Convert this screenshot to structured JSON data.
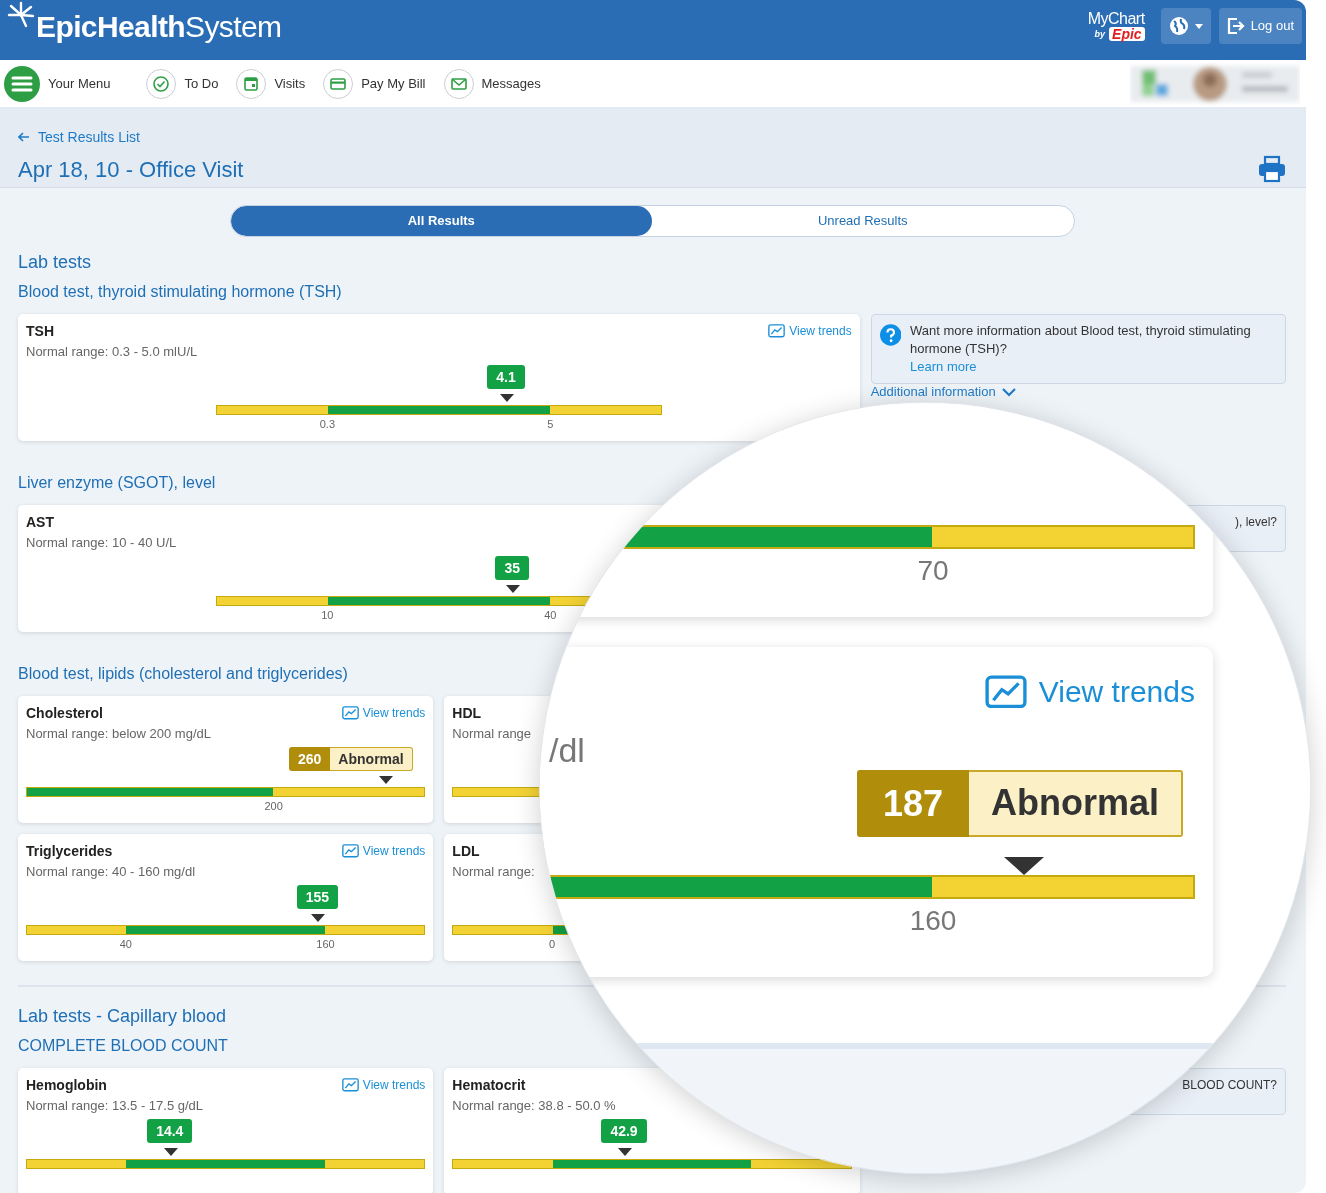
{
  "header": {
    "logo": "**EpicHealth**System",
    "mychart_logo": [
      "MyChart",
      "by",
      "Epic"
    ],
    "logout": "Log out"
  },
  "nav": [
    {
      "label": "Your Menu",
      "kind": "menu"
    },
    {
      "label": "To Do",
      "kind": "todo"
    },
    {
      "label": "Visits",
      "kind": "visits"
    },
    {
      "label": "Pay My Bill",
      "kind": "bill"
    },
    {
      "label": "Messages",
      "kind": "messages"
    }
  ],
  "back_link": "Test Results List",
  "title": "Apr 18, 10 - Office Visit",
  "filter_tabs": [
    {
      "label": "All Results",
      "selected": true
    },
    {
      "label": "Unread Results",
      "selected": false
    }
  ],
  "sections": [
    {
      "heading": "Lab tests",
      "groups": [
        {
          "title": "Blood test, thyroid stimulating hormone (TSH)",
          "kind": "wide",
          "results": [
            {
              "name": "TSH",
              "range": "Normal range: 0.3 - 5.0 mlU/L",
              "trends": "View trends",
              "value": "4.1",
              "abnormal": false,
              "level": 0.65,
              "kind": "range",
              "ticks": [
                {
                  "label": "0.3",
                  "kind": "low"
                },
                {
                  "label": "5",
                  "kind": "high"
                }
              ]
            }
          ],
          "info": {
            "kind": "question",
            "text": "Want more information about Blood test, thyroid stimulating hormone (TSH)?",
            "link": "Learn more",
            "more": "Additional information"
          }
        },
        {
          "title": "Liver enzyme (SGOT), level",
          "kind": "wide",
          "results": [
            {
              "name": "AST",
              "range": "Normal range: 10 - 40 U/L",
              "value": "35",
              "abnormal": false,
              "level": 0.665,
              "kind": "range",
              "ticks": [
                {
                  "label": "10",
                  "kind": "low"
                },
                {
                  "label": "40",
                  "kind": "high"
                }
              ]
            }
          ],
          "info": {
            "kind": "partial",
            "text": "), level?"
          }
        },
        {
          "title": "Blood test, lipids (cholesterol and triglycerides)",
          "kind": "grid",
          "results": [
            {
              "name": "Cholesterol",
              "range": "Normal range: below 200 mg/dL",
              "trends": "View trends",
              "value": "260",
              "abnormal": true,
              "flag": "Abnormal",
              "level": 0.9,
              "kind": "upper_limit",
              "ticks": [
                {
                  "label": "200",
                  "kind": "limit"
                }
              ]
            },
            {
              "name": "HDL",
              "range": "Normal range",
              "kind": "range"
            },
            {
              "name": "Triglycerides",
              "range": "Normal range: 40 - 160 mg/dl",
              "trends": "View trends",
              "value": "155",
              "abnormal": false,
              "level": 0.73,
              "kind": "range",
              "ticks": [
                {
                  "label": "40",
                  "kind": "low"
                },
                {
                  "label": "160",
                  "kind": "high"
                }
              ]
            },
            {
              "name": "LDL",
              "range": "Normal range:",
              "kind": "range",
              "ticks": [
                {
                  "label": "0",
                  "kind": "low"
                }
              ]
            }
          ]
        }
      ]
    },
    {
      "heading": "Lab tests - Capillary blood",
      "groups": [
        {
          "title": "COMPLETE BLOOD COUNT",
          "kind": "grid",
          "results": [
            {
              "name": "Hemoglobin",
              "range": "Normal range: 13.5 - 17.5 g/dL",
              "trends": "View trends",
              "value": "14.4",
              "abnormal": false,
              "level": 0.36,
              "kind": "range"
            },
            {
              "name": "Hematocrit",
              "range": "Normal range: 38.8 - 50.0 %",
              "value": "42.9",
              "abnormal": false,
              "level": 0.43,
              "kind": "range"
            }
          ],
          "info": {
            "kind": "partial",
            "text": "BLOOD COUNT?"
          }
        }
      ]
    }
  ],
  "magnifier": {
    "cards": [
      {
        "kind": "range",
        "ticks": [
          {
            "label": "70",
            "kind": "high"
          }
        ]
      },
      {
        "unit": "/dl",
        "trends": "View trends",
        "value": "187",
        "abnormal": true,
        "flag": "Abnormal",
        "level": 0.835,
        "kind": "range",
        "ticks": [
          {
            "label": "160",
            "kind": "high"
          }
        ]
      }
    ]
  }
}
